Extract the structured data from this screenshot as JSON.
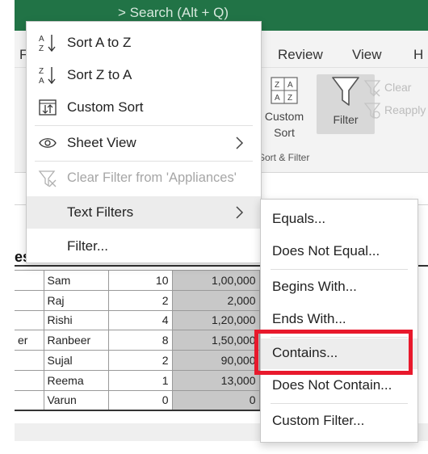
{
  "titlebar": {
    "search_fragment": ">  Search (Alt + Q)"
  },
  "ribbon_tabs": [
    {
      "label": "F"
    },
    {
      "label": "Review"
    },
    {
      "label": "View"
    },
    {
      "label": "H"
    }
  ],
  "ribbon": {
    "custom_sort_label": "Custom\nSort",
    "filter_label": "Filter",
    "clear_label": "Clear",
    "reapply_label": "Reapply",
    "group_label": "Sort & Filter"
  },
  "sheet": {
    "header_fragment": "es",
    "rows": [
      {
        "a": "",
        "name": "Sam",
        "qty": "10",
        "amount": "1,00,000"
      },
      {
        "a": "",
        "name": "Raj",
        "qty": "2",
        "amount": "2,000"
      },
      {
        "a": "",
        "name": "Rishi",
        "qty": "4",
        "amount": "1,20,000"
      },
      {
        "a": "er",
        "name": "Ranbeer",
        "qty": "8",
        "amount": "1,50,000"
      },
      {
        "a": "",
        "name": "Sujal",
        "qty": "2",
        "amount": "90,000"
      },
      {
        "a": "",
        "name": "Reema",
        "qty": "1",
        "amount": "13,000"
      },
      {
        "a": "",
        "name": "Varun",
        "qty": "0",
        "amount": "0"
      }
    ]
  },
  "context_menu": {
    "sort_az": "Sort A to Z",
    "sort_za": "Sort Z to A",
    "custom_sort": "Custom Sort",
    "sheet_view": "Sheet View",
    "clear_filter": "Clear Filter from 'Appliances'",
    "text_filters": "Text Filters",
    "filter": "Filter..."
  },
  "text_filters_submenu": {
    "equals": "Equals...",
    "does_not_equal": "Does Not Equal...",
    "begins_with": "Begins With...",
    "ends_with": "Ends With...",
    "contains": "Contains...",
    "does_not_contain": "Does Not Contain...",
    "custom_filter": "Custom Filter..."
  },
  "colors": {
    "excel_green": "#217346",
    "highlight_red": "#e8192c",
    "menu_hover": "#ececec"
  }
}
